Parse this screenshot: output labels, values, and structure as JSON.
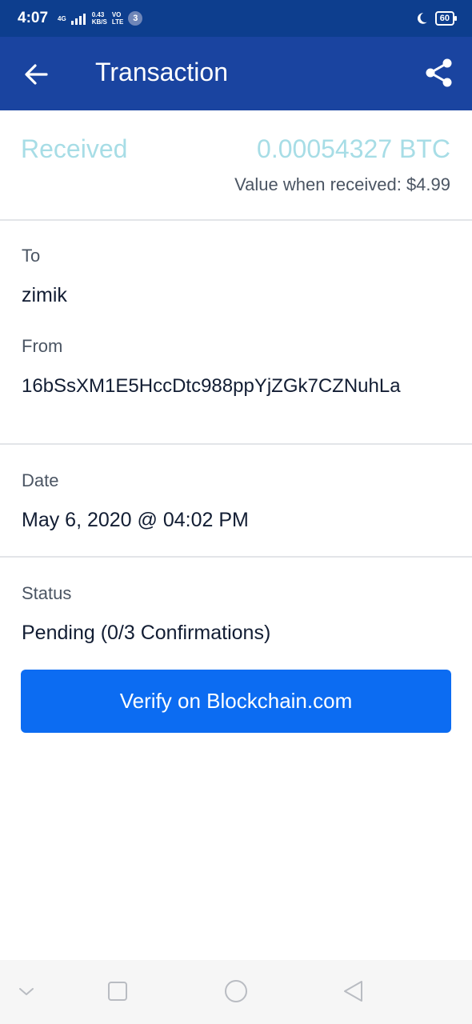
{
  "status_bar": {
    "time": "4:07",
    "network_type": "4G",
    "speed_value": "0.43",
    "speed_unit": "KB/S",
    "volte_top": "VO",
    "volte_bottom": "LTE",
    "notification_count": "3",
    "battery": "60"
  },
  "app_bar": {
    "title": "Transaction",
    "back_icon": "arrow-left-icon",
    "share_icon": "share-icon"
  },
  "summary": {
    "direction": "Received",
    "amount": "0.00054327 BTC",
    "value_text": "Value when received: $4.99"
  },
  "details": {
    "to_label": "To",
    "to_value": "zimik",
    "from_label": "From",
    "from_value": "16bSsXM1E5HccDtc988ppYjZGk7CZNuhLa",
    "date_label": "Date",
    "date_value": "May 6, 2020 @ 04:02 PM",
    "status_label": "Status",
    "status_value": "Pending (0/3 Confirmations)"
  },
  "actions": {
    "verify_label": "Verify on Blockchain.com"
  },
  "nav_bar": {
    "items": [
      "chevron-down-icon",
      "recents-square-icon",
      "home-circle-icon",
      "back-triangle-icon"
    ]
  },
  "colors": {
    "status_bar": "#0d3e8e",
    "app_bar": "#1a44a0",
    "received_accent": "#a7dde6",
    "button": "#0c6cf2"
  }
}
